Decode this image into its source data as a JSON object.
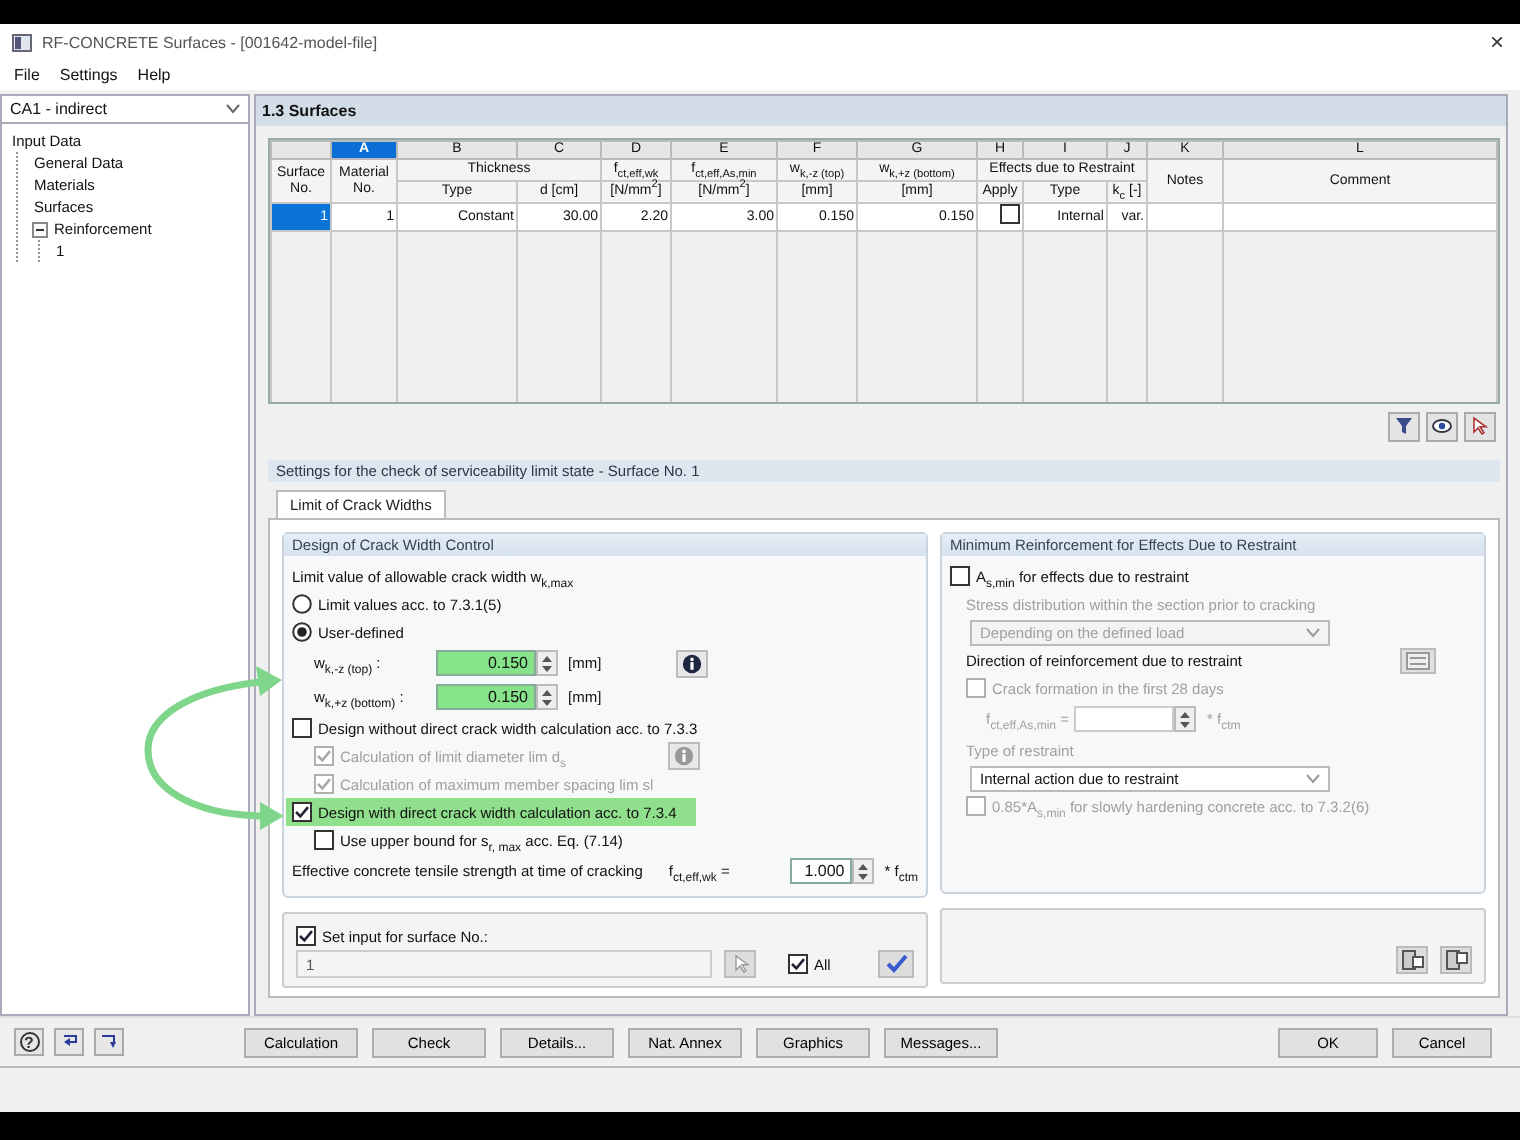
{
  "window": {
    "title": "RF-CONCRETE Surfaces - [001642-model-file]",
    "close": "×"
  },
  "menu": [
    "File",
    "Settings",
    "Help"
  ],
  "sidebar": {
    "case": "CA1 - indirect",
    "tree": [
      {
        "label": "Input Data",
        "children": [
          {
            "label": "General Data"
          },
          {
            "label": "Materials"
          },
          {
            "label": "Surfaces"
          },
          {
            "label": "Reinforcement",
            "expanded": true,
            "children": [
              {
                "label": "1"
              }
            ]
          }
        ]
      }
    ]
  },
  "panel": {
    "title": "1.3 Surfaces"
  },
  "table": {
    "columns": [
      {
        "label": "Surface No."
      },
      {
        "letter": "A",
        "label": "Material No.",
        "selected": true
      },
      {
        "letter": "B",
        "group": "Thickness",
        "label": "Type",
        "selected": false
      },
      {
        "letter": "C",
        "in_group": true,
        "label": "d [cm]",
        "selected": false
      },
      {
        "letter": "D",
        "label": "f$_{ct,eff,wk}$",
        "unit": "[N/mm$^{2}$]",
        "selected": false
      },
      {
        "letter": "E",
        "label": "f$_{ct,eff,As,min}$",
        "unit": "[N/mm$^{2}$]",
        "selected": false
      },
      {
        "letter": "F",
        "label": "w$_{k,-z (top)}$",
        "unit": "[mm]",
        "selected": false
      },
      {
        "letter": "G",
        "label": "w$_{k,+z (bottom)}$",
        "unit": "[mm]",
        "selected": false
      },
      {
        "letter": "H",
        "group": "Effects due to Restraint",
        "label": "Apply",
        "selected": false
      },
      {
        "letter": "I",
        "in_group": true,
        "label": "Type",
        "selected": false
      },
      {
        "letter": "J",
        "in_group": true,
        "label": "k$_{c}$ [-]",
        "selected": false
      },
      {
        "letter": "K",
        "label": "Notes",
        "selected": false
      },
      {
        "letter": "L",
        "label": "Comment",
        "selected": false
      }
    ],
    "rows": [
      {
        "selected": true,
        "cells": [
          {
            "text": "1"
          },
          {
            "text": "1"
          },
          {
            "text": "Constant"
          },
          {
            "text": "30.00"
          },
          {
            "text": "2.20"
          },
          {
            "text": "3.00"
          },
          {
            "text": "0.150"
          },
          {
            "text": "0.150"
          },
          {
            "kind": "check",
            "checked": false
          },
          {
            "text": "Internal"
          },
          {
            "text": "var."
          }
        ]
      }
    ]
  },
  "settings": {
    "title": "Settings for the check of serviceability limit state - Surface No. 1",
    "tabs": [
      {
        "label": "Limit of Crack Widths",
        "selected": true
      }
    ],
    "left": {
      "title": "Design of Crack Width Control",
      "rows": [
        {
          "kind": "text",
          "label": "Limit value of allowable crack width w$_{k,max}$",
          "disabled": false,
          "button": false
        },
        {
          "kind": "radio",
          "label": "Limit values acc. to 7.3.1(5)",
          "selected": false,
          "disabled": false
        },
        {
          "kind": "radio",
          "label": "User-defined",
          "selected": true,
          "disabled": false,
          "children": [
            {
              "kind": "value",
              "symbol": "w$_{k,-z (top)}$ :",
              "value": "0.150",
              "unit": "[mm]",
              "highlighted": true,
              "info": true,
              "disabled": false
            },
            {
              "kind": "value",
              "symbol": "w$_{k,+z (bottom)}$ :",
              "value": "0.150",
              "unit": "[mm]",
              "highlighted": true,
              "info": false,
              "disabled": false
            }
          ]
        },
        {
          "kind": "check",
          "label": "Design without direct crack width calculation acc. to 7.3.3",
          "checked": false,
          "disabled": false,
          "highlighted": false,
          "info": false,
          "children": [
            {
              "kind": "check",
              "label": "Calculation of limit diameter lim d$_{s}$",
              "checked": true,
              "disabled": true,
              "highlighted": false,
              "info": true
            },
            {
              "kind": "check",
              "label": "Calculation of maximum member spacing lim sl",
              "checked": true,
              "disabled": true,
              "highlighted": false,
              "info": false
            }
          ]
        },
        {
          "kind": "check",
          "label": "Design with direct crack width calculation acc. to 7.3.4",
          "checked": true,
          "disabled": false,
          "highlighted": true,
          "info": false,
          "children": [
            {
              "kind": "check",
              "label": "Use upper bound for s$_{r, max}$ acc. Eq. (7.14)",
              "checked": false,
              "disabled": false,
              "highlighted": false,
              "info": false
            }
          ]
        },
        {
          "kind": "value",
          "label": "Effective concrete tensile strength at time of cracking",
          "symbol": "f$_{ct,eff,wk}$ =",
          "value": "1.000",
          "unit": "* f$_{ctm}$",
          "highlighted": false,
          "info": false,
          "disabled": false
        }
      ]
    },
    "left_footer": {
      "label": "Set input for surface No.:",
      "checked": true,
      "value": "1",
      "all": {
        "label": "All",
        "checked": true
      }
    },
    "right": {
      "title": "Minimum Reinforcement for Effects Due to Restraint",
      "rows": [
        {
          "kind": "check",
          "label": "A$_{s,min}$ for effects due to restraint",
          "checked": false,
          "disabled": false,
          "highlighted": false,
          "info": false
        },
        {
          "kind": "text",
          "label": "Stress distribution within the section prior to cracking",
          "disabled": true,
          "button": false
        },
        {
          "kind": "select",
          "value": "Depending on the defined load",
          "disabled": true
        },
        {
          "kind": "text",
          "label": "Direction of reinforcement due to restraint",
          "disabled": false,
          "button": true
        },
        {
          "kind": "check",
          "label": "Crack formation in the first 28 days",
          "checked": false,
          "disabled": true,
          "highlighted": false,
          "info": false
        },
        {
          "kind": "value",
          "symbol": "f$_{ct,eff,As,min}$ =",
          "unit": "* f$_{ctm}$",
          "highlighted": false,
          "info": false,
          "disabled": true
        },
        {
          "kind": "text",
          "label": "Type of restraint",
          "disabled": true,
          "button": false
        },
        {
          "kind": "select",
          "value": "Internal action due to restraint",
          "disabled": false
        },
        {
          "kind": "check",
          "label": "0.85*A$_{s,min}$ for slowly hardening concrete acc. to 7.3.2(6)",
          "checked": false,
          "disabled": true,
          "highlighted": false,
          "info": false
        }
      ]
    }
  },
  "footer": {
    "help_glyph": "?",
    "buttons": [
      "Calculation",
      "Check",
      "Details...",
      "Nat. Annex",
      "Graphics",
      "Messages..."
    ],
    "dialog_buttons": [
      "OK",
      "Cancel"
    ]
  },
  "annotation": {
    "kind": "double-arrow"
  }
}
